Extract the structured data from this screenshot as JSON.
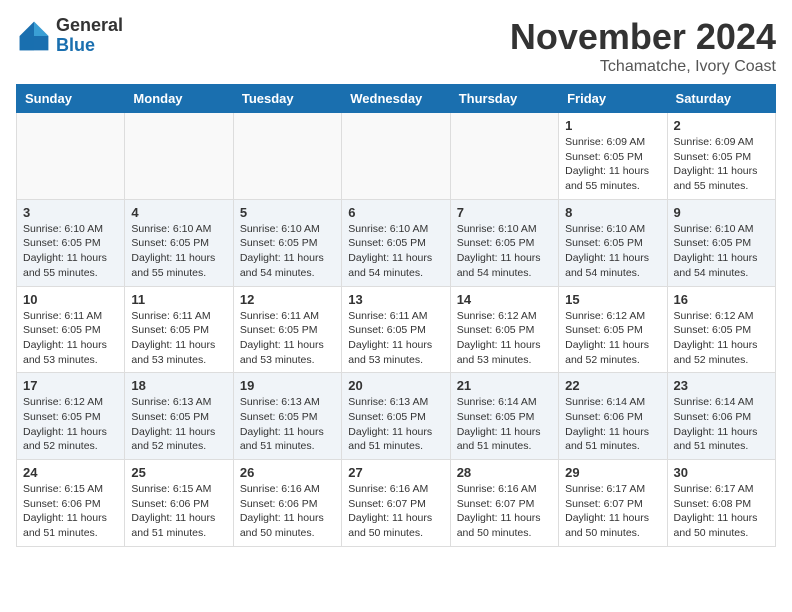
{
  "header": {
    "logo_general": "General",
    "logo_blue": "Blue",
    "month_title": "November 2024",
    "location": "Tchamatche, Ivory Coast"
  },
  "weekdays": [
    "Sunday",
    "Monday",
    "Tuesday",
    "Wednesday",
    "Thursday",
    "Friday",
    "Saturday"
  ],
  "weeks": [
    [
      {
        "day": "",
        "info": ""
      },
      {
        "day": "",
        "info": ""
      },
      {
        "day": "",
        "info": ""
      },
      {
        "day": "",
        "info": ""
      },
      {
        "day": "",
        "info": ""
      },
      {
        "day": "1",
        "info": "Sunrise: 6:09 AM\nSunset: 6:05 PM\nDaylight: 11 hours and 55 minutes."
      },
      {
        "day": "2",
        "info": "Sunrise: 6:09 AM\nSunset: 6:05 PM\nDaylight: 11 hours and 55 minutes."
      }
    ],
    [
      {
        "day": "3",
        "info": "Sunrise: 6:10 AM\nSunset: 6:05 PM\nDaylight: 11 hours and 55 minutes."
      },
      {
        "day": "4",
        "info": "Sunrise: 6:10 AM\nSunset: 6:05 PM\nDaylight: 11 hours and 55 minutes."
      },
      {
        "day": "5",
        "info": "Sunrise: 6:10 AM\nSunset: 6:05 PM\nDaylight: 11 hours and 54 minutes."
      },
      {
        "day": "6",
        "info": "Sunrise: 6:10 AM\nSunset: 6:05 PM\nDaylight: 11 hours and 54 minutes."
      },
      {
        "day": "7",
        "info": "Sunrise: 6:10 AM\nSunset: 6:05 PM\nDaylight: 11 hours and 54 minutes."
      },
      {
        "day": "8",
        "info": "Sunrise: 6:10 AM\nSunset: 6:05 PM\nDaylight: 11 hours and 54 minutes."
      },
      {
        "day": "9",
        "info": "Sunrise: 6:10 AM\nSunset: 6:05 PM\nDaylight: 11 hours and 54 minutes."
      }
    ],
    [
      {
        "day": "10",
        "info": "Sunrise: 6:11 AM\nSunset: 6:05 PM\nDaylight: 11 hours and 53 minutes."
      },
      {
        "day": "11",
        "info": "Sunrise: 6:11 AM\nSunset: 6:05 PM\nDaylight: 11 hours and 53 minutes."
      },
      {
        "day": "12",
        "info": "Sunrise: 6:11 AM\nSunset: 6:05 PM\nDaylight: 11 hours and 53 minutes."
      },
      {
        "day": "13",
        "info": "Sunrise: 6:11 AM\nSunset: 6:05 PM\nDaylight: 11 hours and 53 minutes."
      },
      {
        "day": "14",
        "info": "Sunrise: 6:12 AM\nSunset: 6:05 PM\nDaylight: 11 hours and 53 minutes."
      },
      {
        "day": "15",
        "info": "Sunrise: 6:12 AM\nSunset: 6:05 PM\nDaylight: 11 hours and 52 minutes."
      },
      {
        "day": "16",
        "info": "Sunrise: 6:12 AM\nSunset: 6:05 PM\nDaylight: 11 hours and 52 minutes."
      }
    ],
    [
      {
        "day": "17",
        "info": "Sunrise: 6:12 AM\nSunset: 6:05 PM\nDaylight: 11 hours and 52 minutes."
      },
      {
        "day": "18",
        "info": "Sunrise: 6:13 AM\nSunset: 6:05 PM\nDaylight: 11 hours and 52 minutes."
      },
      {
        "day": "19",
        "info": "Sunrise: 6:13 AM\nSunset: 6:05 PM\nDaylight: 11 hours and 51 minutes."
      },
      {
        "day": "20",
        "info": "Sunrise: 6:13 AM\nSunset: 6:05 PM\nDaylight: 11 hours and 51 minutes."
      },
      {
        "day": "21",
        "info": "Sunrise: 6:14 AM\nSunset: 6:05 PM\nDaylight: 11 hours and 51 minutes."
      },
      {
        "day": "22",
        "info": "Sunrise: 6:14 AM\nSunset: 6:06 PM\nDaylight: 11 hours and 51 minutes."
      },
      {
        "day": "23",
        "info": "Sunrise: 6:14 AM\nSunset: 6:06 PM\nDaylight: 11 hours and 51 minutes."
      }
    ],
    [
      {
        "day": "24",
        "info": "Sunrise: 6:15 AM\nSunset: 6:06 PM\nDaylight: 11 hours and 51 minutes."
      },
      {
        "day": "25",
        "info": "Sunrise: 6:15 AM\nSunset: 6:06 PM\nDaylight: 11 hours and 51 minutes."
      },
      {
        "day": "26",
        "info": "Sunrise: 6:16 AM\nSunset: 6:06 PM\nDaylight: 11 hours and 50 minutes."
      },
      {
        "day": "27",
        "info": "Sunrise: 6:16 AM\nSunset: 6:07 PM\nDaylight: 11 hours and 50 minutes."
      },
      {
        "day": "28",
        "info": "Sunrise: 6:16 AM\nSunset: 6:07 PM\nDaylight: 11 hours and 50 minutes."
      },
      {
        "day": "29",
        "info": "Sunrise: 6:17 AM\nSunset: 6:07 PM\nDaylight: 11 hours and 50 minutes."
      },
      {
        "day": "30",
        "info": "Sunrise: 6:17 AM\nSunset: 6:08 PM\nDaylight: 11 hours and 50 minutes."
      }
    ]
  ]
}
